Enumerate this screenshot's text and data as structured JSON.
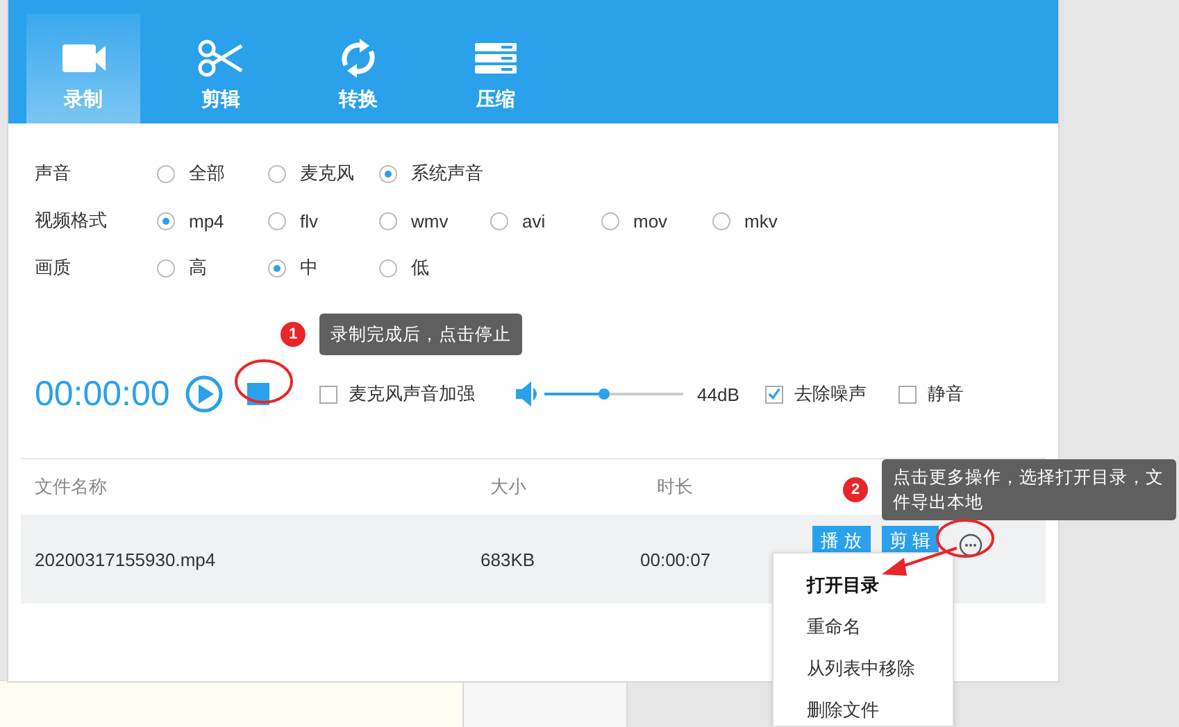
{
  "tabs": [
    {
      "label": "录制",
      "selected": true
    },
    {
      "label": "剪辑",
      "selected": false
    },
    {
      "label": "转换",
      "selected": false
    },
    {
      "label": "压缩",
      "selected": false
    }
  ],
  "settings": [
    {
      "label": "声音",
      "options": [
        {
          "label": "全部",
          "selected": false
        },
        {
          "label": "麦克风",
          "selected": false
        },
        {
          "label": "系统声音",
          "selected": true
        }
      ]
    },
    {
      "label": "视频格式",
      "options": [
        {
          "label": "mp4",
          "selected": true
        },
        {
          "label": "flv",
          "selected": false
        },
        {
          "label": "wmv",
          "selected": false
        },
        {
          "label": "avi",
          "selected": false
        },
        {
          "label": "mov",
          "selected": false
        },
        {
          "label": "mkv",
          "selected": false
        }
      ]
    },
    {
      "label": "画质",
      "options": [
        {
          "label": "高",
          "selected": false
        },
        {
          "label": "中",
          "selected": true
        },
        {
          "label": "低",
          "selected": false
        }
      ]
    }
  ],
  "recorder": {
    "time": "00:00:00",
    "mic_boost": {
      "label": "麦克风声音加强",
      "checked": false
    },
    "volume": {
      "level": 0.43,
      "reading": "44dB"
    },
    "denoise": {
      "label": "去除噪声",
      "checked": true
    },
    "mute": {
      "label": "静音",
      "checked": false
    }
  },
  "table": {
    "columns": [
      "文件名称",
      "大小",
      "时长"
    ],
    "rows": [
      {
        "name": "20200317155930.mp4",
        "size": "683KB",
        "duration": "00:00:07",
        "actions": [
          "播 放",
          "剪 辑"
        ]
      }
    ]
  },
  "menu": [
    {
      "label": "打开目录",
      "highlighted": true
    },
    {
      "label": "重命名",
      "highlighted": false
    },
    {
      "label": "从列表中移除",
      "highlighted": false
    },
    {
      "label": "删除文件",
      "highlighted": false
    }
  ],
  "tips": [
    {
      "number": "1",
      "text": "录制完成后，点击停止"
    },
    {
      "number": "2",
      "text": "点击更多操作，选择打开目录，文件导出本地"
    }
  ]
}
